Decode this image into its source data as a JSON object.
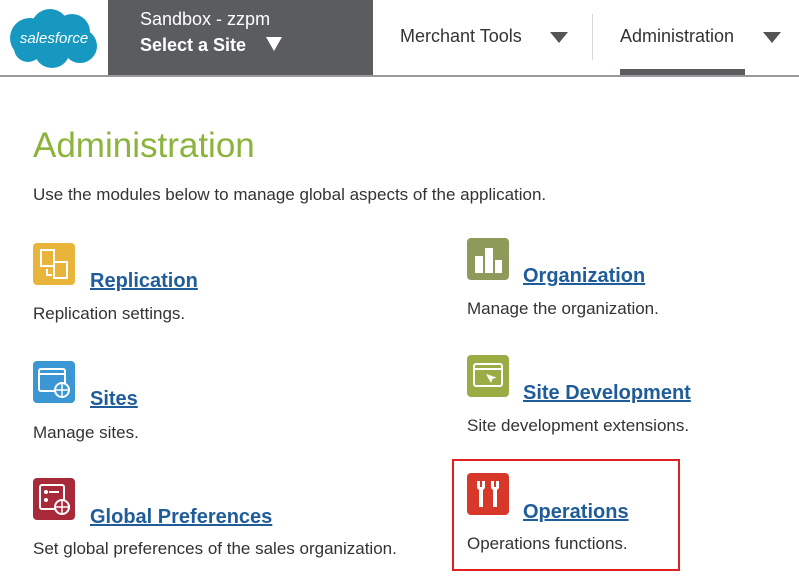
{
  "header": {
    "logo_text": "salesforce",
    "sandbox_name": "Sandbox - zzpm",
    "site_selector": "Select a Site",
    "nav": [
      {
        "label": "Merchant Tools"
      },
      {
        "label": "Administration"
      }
    ]
  },
  "page": {
    "title": "Administration",
    "intro": "Use the modules below to manage global aspects of the application."
  },
  "modules": {
    "replication": {
      "title": "Replication",
      "desc": "Replication settings.",
      "icon": "replication-icon"
    },
    "organization": {
      "title": "Organization",
      "desc": "Manage the organization.",
      "icon": "organization-icon"
    },
    "sites": {
      "title": "Sites",
      "desc": "Manage sites.",
      "icon": "sites-icon"
    },
    "site_development": {
      "title": "Site Development",
      "desc": "Site development extensions.",
      "icon": "site-development-icon"
    },
    "global_preferences": {
      "title": "Global Preferences",
      "desc": "Set global preferences of the sales organization.",
      "icon": "global-preferences-icon"
    },
    "operations": {
      "title": "Operations",
      "desc": "Operations functions.",
      "icon": "wrench-icon"
    }
  },
  "colors": {
    "title_green": "#8cb33c",
    "link_blue": "#1f5c9a",
    "highlight_red": "#e02020",
    "sandbox_bg": "#5b5c5f",
    "logo_blue": "#1798c1"
  }
}
